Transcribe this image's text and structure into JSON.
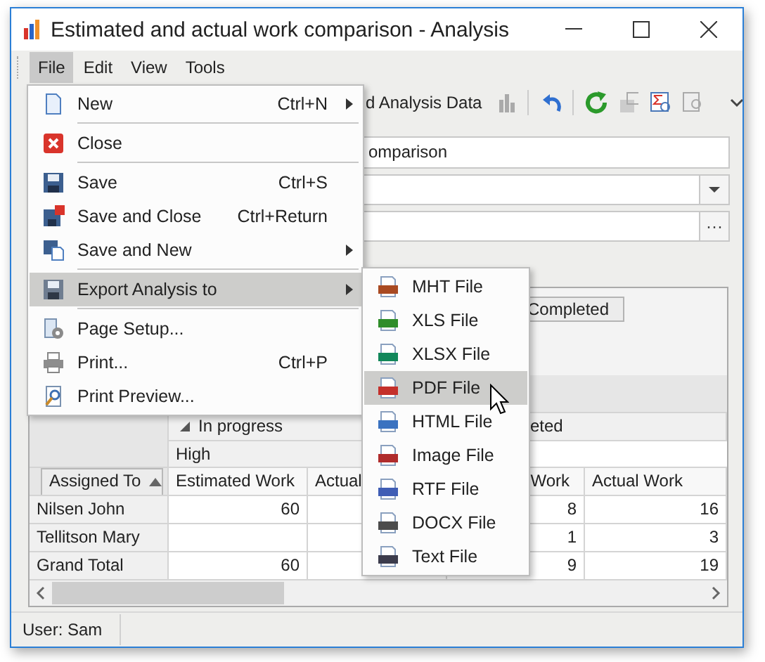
{
  "window": {
    "title": "Estimated and actual work comparison - Analysis"
  },
  "menu_bar": [
    {
      "label": "File",
      "selected": true
    },
    {
      "label": "Edit",
      "selected": false
    },
    {
      "label": "View",
      "selected": false
    },
    {
      "label": "Tools",
      "selected": false
    }
  ],
  "toolbar": {
    "button_text": "d Analysis Data"
  },
  "fields": [
    {
      "kind": "text",
      "value": "omparison"
    },
    {
      "kind": "combo"
    },
    {
      "kind": "button_edit",
      "button": "···"
    }
  ],
  "pivot": {
    "filter_buttons": [
      {
        "label": "Completed"
      }
    ],
    "column_groups": [
      {
        "label": "In progress",
        "expanded": true
      },
      {
        "label": "eted"
      }
    ],
    "priority": "High",
    "row_header": "Assigned To",
    "columns": [
      "Estimated Work",
      "Actual",
      "Work",
      "Actual Work"
    ],
    "rows": [
      {
        "name": "Nilsen John",
        "cells": [
          "60",
          null,
          "8",
          "16"
        ]
      },
      {
        "name": "Tellitson Mary",
        "cells": [
          null,
          null,
          "1",
          "3"
        ]
      },
      {
        "name": "Grand Total",
        "cells": [
          "60",
          null,
          "9",
          "19"
        ]
      }
    ]
  },
  "file_menu": [
    {
      "kind": "new",
      "label": "New",
      "shortcut": "Ctrl+N",
      "submenu": true,
      "selected": false,
      "separator_after": true
    },
    {
      "kind": "close",
      "label": "Close",
      "submenu": false,
      "selected": false,
      "separator_after": true
    },
    {
      "kind": "save",
      "label": "Save",
      "shortcut": "Ctrl+S",
      "submenu": false,
      "selected": false,
      "separator_after": false
    },
    {
      "kind": "saveclose",
      "label": "Save and Close",
      "shortcut": "Ctrl+Return",
      "submenu": false,
      "selected": false,
      "separator_after": false
    },
    {
      "kind": "savenew",
      "label": "Save and New",
      "submenu": true,
      "selected": false,
      "separator_after": true
    },
    {
      "kind": "export",
      "label": "Export Analysis to",
      "submenu": true,
      "selected": true,
      "separator_after": true
    },
    {
      "kind": "setup",
      "label": "Page Setup...",
      "submenu": false,
      "selected": false,
      "separator_after": false
    },
    {
      "kind": "print",
      "label": "Print...",
      "shortcut": "Ctrl+P",
      "submenu": false,
      "selected": false,
      "separator_after": false
    },
    {
      "kind": "preview",
      "label": "Print Preview...",
      "submenu": false,
      "selected": false,
      "separator_after": false
    }
  ],
  "export_menu": [
    {
      "kind": "mht",
      "label": "MHT File",
      "selected": false
    },
    {
      "kind": "xls",
      "label": "XLS File",
      "selected": false
    },
    {
      "kind": "xlsx",
      "label": "XLSX File",
      "selected": false
    },
    {
      "kind": "pdf",
      "label": "PDF File",
      "selected": true
    },
    {
      "kind": "html",
      "label": "HTML File",
      "selected": false
    },
    {
      "kind": "image",
      "label": "Image File",
      "selected": false
    },
    {
      "kind": "rtf",
      "label": "RTF File",
      "selected": false
    },
    {
      "kind": "docx",
      "label": "DOCX File",
      "selected": false
    },
    {
      "kind": "text",
      "label": "Text File",
      "selected": false
    }
  ],
  "status_bar": {
    "user": "User: Sam"
  }
}
